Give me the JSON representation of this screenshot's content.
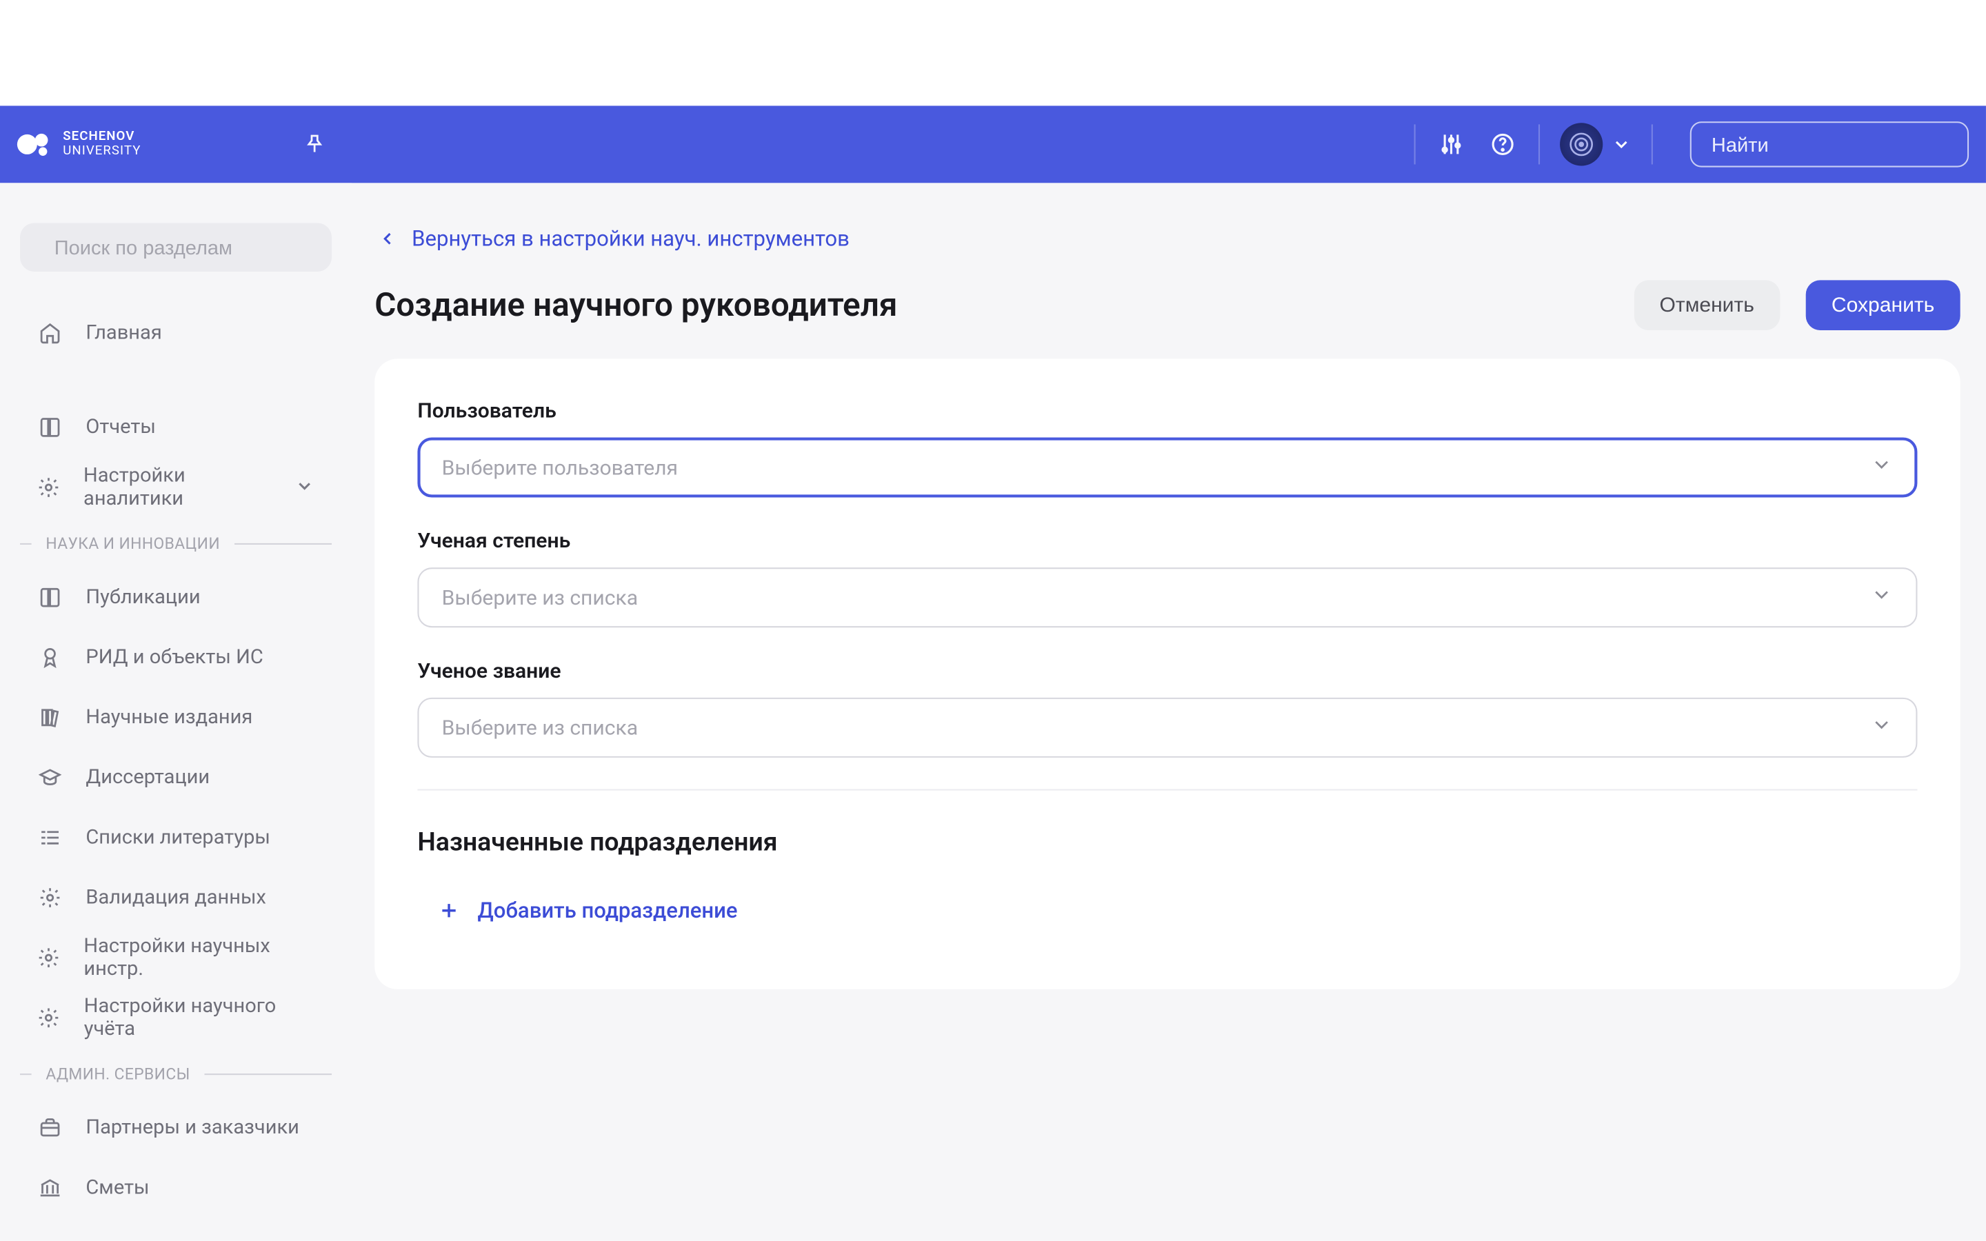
{
  "header": {
    "logo_line1": "SECHENOV",
    "logo_line2": "UNIVERSITY",
    "search_placeholder": "Найти"
  },
  "sidebar": {
    "search_placeholder": "Поиск по разделам",
    "items_top": [
      {
        "label": "Главная"
      }
    ],
    "items_mid": [
      {
        "label": "Отчеты"
      },
      {
        "label": "Настройки аналитики",
        "chev": true
      }
    ],
    "section1": "НАУКА И ИННОВАЦИИ",
    "items_sci": [
      {
        "label": "Публикации"
      },
      {
        "label": "РИД и объекты ИС"
      },
      {
        "label": "Научные издания"
      },
      {
        "label": "Диссертации"
      },
      {
        "label": "Списки литературы"
      },
      {
        "label": "Валидация данных"
      },
      {
        "label": "Настройки научных инстр."
      },
      {
        "label": "Настройки научного учёта"
      }
    ],
    "section2": "АДМИН. СЕРВИСЫ",
    "items_admin": [
      {
        "label": "Партнеры и заказчики"
      },
      {
        "label": "Сметы"
      }
    ]
  },
  "main": {
    "back_label": "Вернуться в настройки науч. инструментов",
    "page_title": "Создание научного руководителя",
    "cancel": "Отменить",
    "save": "Сохранить",
    "fields": {
      "user_label": "Пользователь",
      "user_ph": "Выберите пользователя",
      "degree_label": "Ученая степень",
      "degree_ph": "Выберите из списка",
      "title_label": "Ученое звание",
      "title_ph": "Выберите из списка"
    },
    "subdiv_title": "Назначенные подразделения",
    "add_subdiv": "Добавить подразделение"
  }
}
